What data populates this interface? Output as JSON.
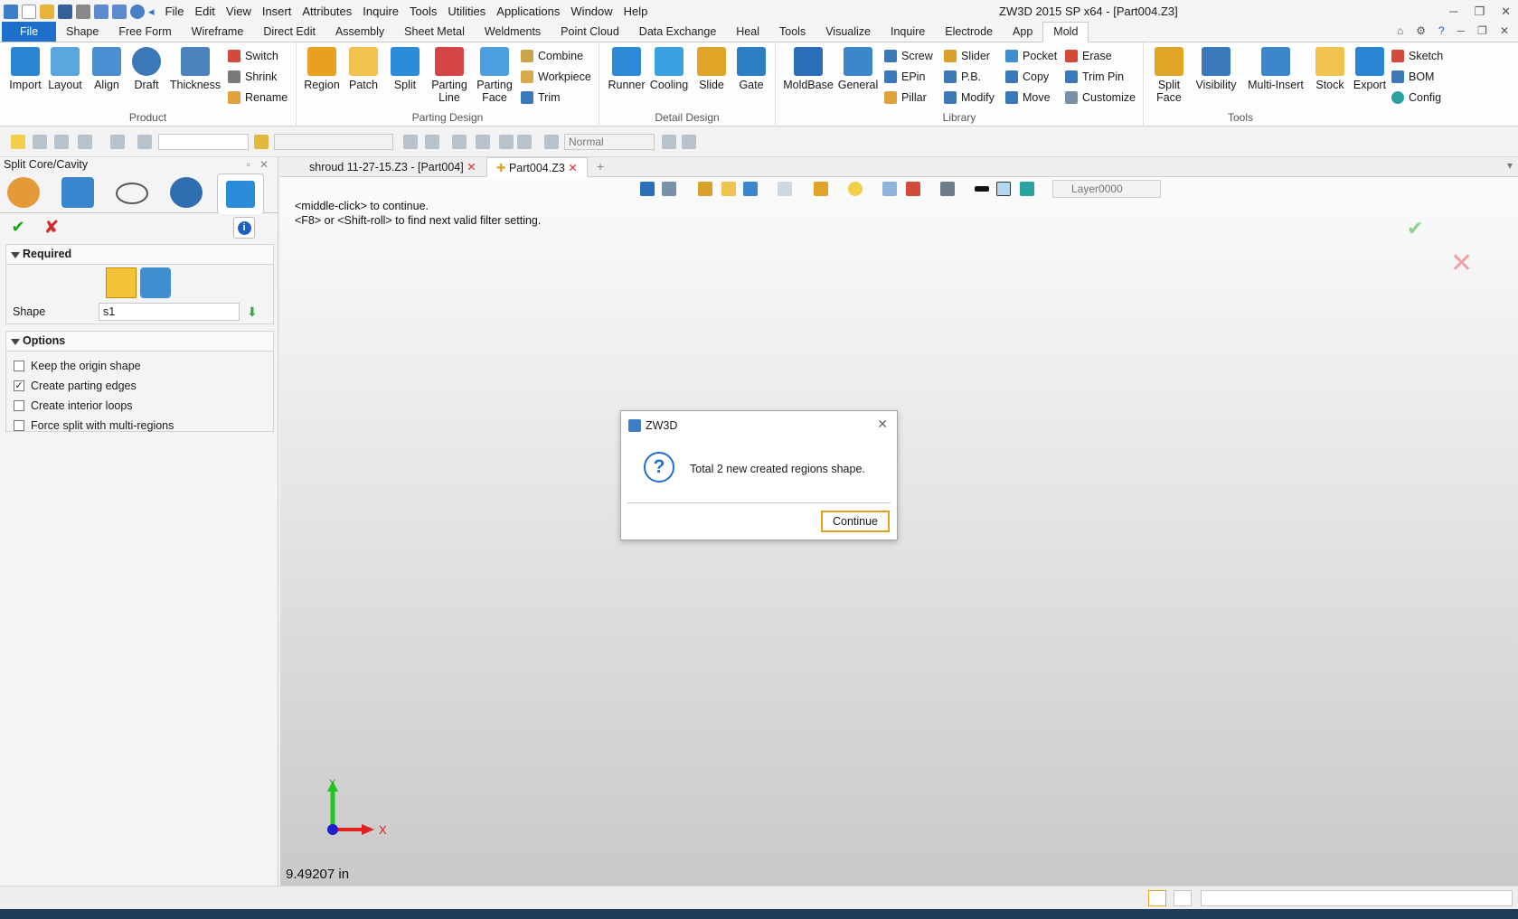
{
  "window_title": "ZW3D 2015 SP x64 - [Part004.Z3]",
  "menu": [
    "File",
    "Edit",
    "View",
    "Insert",
    "Attributes",
    "Inquire",
    "Tools",
    "Utilities",
    "Applications",
    "Window",
    "Help"
  ],
  "ribbon_tabs": [
    "File",
    "Shape",
    "Free Form",
    "Wireframe",
    "Direct Edit",
    "Assembly",
    "Sheet Metal",
    "Weldments",
    "Point Cloud",
    "Data Exchange",
    "Heal",
    "Tools",
    "Visualize",
    "Inquire",
    "Electrode",
    "App",
    "Mold"
  ],
  "groups": {
    "product": "Product",
    "parting": "Parting Design",
    "detail": "Detail Design",
    "library": "Library",
    "tools": "Tools"
  },
  "product": {
    "import": "Import",
    "layout": "Layout",
    "align": "Align",
    "draft": "Draft",
    "thickness": "Thickness",
    "switch": "Switch",
    "shrink": "Shrink",
    "rename": "Rename"
  },
  "parting": {
    "region": "Region",
    "patch": "Patch",
    "split": "Split",
    "parting_line": "Parting\nLine",
    "parting_face": "Parting\nFace",
    "combine": "Combine",
    "workpiece": "Workpiece",
    "trim": "Trim"
  },
  "detail": {
    "runner": "Runner",
    "cooling": "Cooling",
    "slide": "Slide",
    "gate": "Gate"
  },
  "library": {
    "moldbase": "MoldBase",
    "general": "General",
    "screw": "Screw",
    "epin": "EPin",
    "pillar": "Pillar",
    "slider": "Slider",
    "pb": "P.B.",
    "modify": "Modify",
    "pocket": "Pocket",
    "copy": "Copy",
    "move": "Move",
    "erase": "Erase",
    "trim_pin": "Trim Pin",
    "customize": "Customize"
  },
  "tools": {
    "split_face": "Split\nFace",
    "visibility": "Visibility",
    "multi_insert": "Multi-Insert",
    "stock": "Stock",
    "export": "Export",
    "sketch": "Sketch",
    "bom": "BOM",
    "config": "Config"
  },
  "toolbar": {
    "filter_mode": "Normal"
  },
  "panel": {
    "title": "Split Core/Cavity",
    "required": "Required",
    "shape_label": "Shape",
    "shape_value": "s1",
    "options": "Options",
    "opts": [
      {
        "label": "Keep the origin shape",
        "checked": false
      },
      {
        "label": "Create parting edges",
        "checked": true
      },
      {
        "label": "Create interior loops",
        "checked": false
      },
      {
        "label": "Force split with multi-regions",
        "checked": false
      }
    ]
  },
  "doc_tabs": [
    "shroud 11-27-15.Z3 - [Part004]",
    "Part004.Z3"
  ],
  "viewport": {
    "layer": "Layer0000",
    "prompt1": "<middle-click> to continue.",
    "prompt2": "<F8> or <Shift-roll> to find next valid filter setting.",
    "coord": "9.49207 in",
    "axis_x": "X",
    "axis_y": "Y"
  },
  "dialog": {
    "title": "ZW3D",
    "message": "Total 2 new created regions shape.",
    "button": "Continue"
  },
  "colors": {
    "accent": "#1e6fc9",
    "ok": "#1aa41a",
    "cancel": "#d12b2b"
  }
}
